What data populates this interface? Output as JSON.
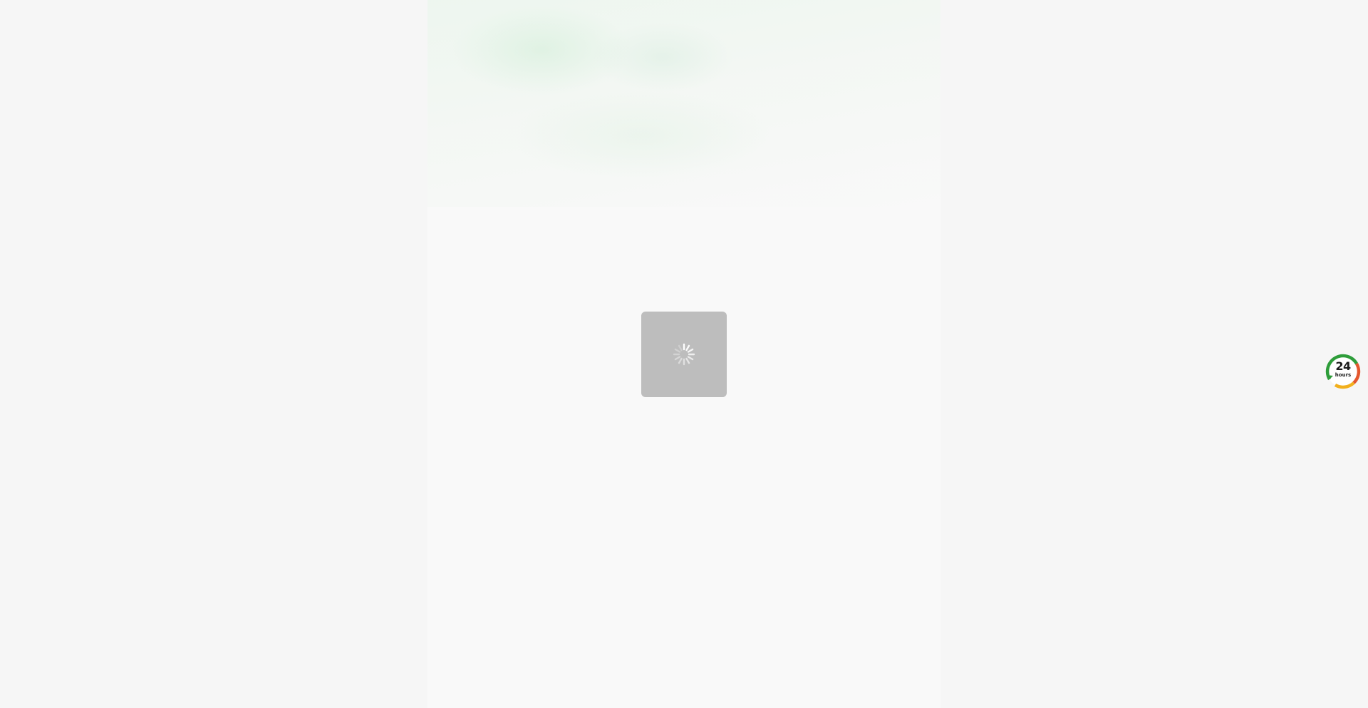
{
  "page": {
    "background_color": "#f6f6f6",
    "column_color": "#f9f9f9"
  },
  "loading": {
    "icon": "spinner-icon",
    "overlay_color": "#bdbdbd"
  },
  "support_badge": {
    "icon": "24-hours-icon",
    "number": "24",
    "unit": "hours",
    "ring_colors": [
      "#2e9d3a",
      "#f2b01e",
      "#e4572e"
    ]
  }
}
